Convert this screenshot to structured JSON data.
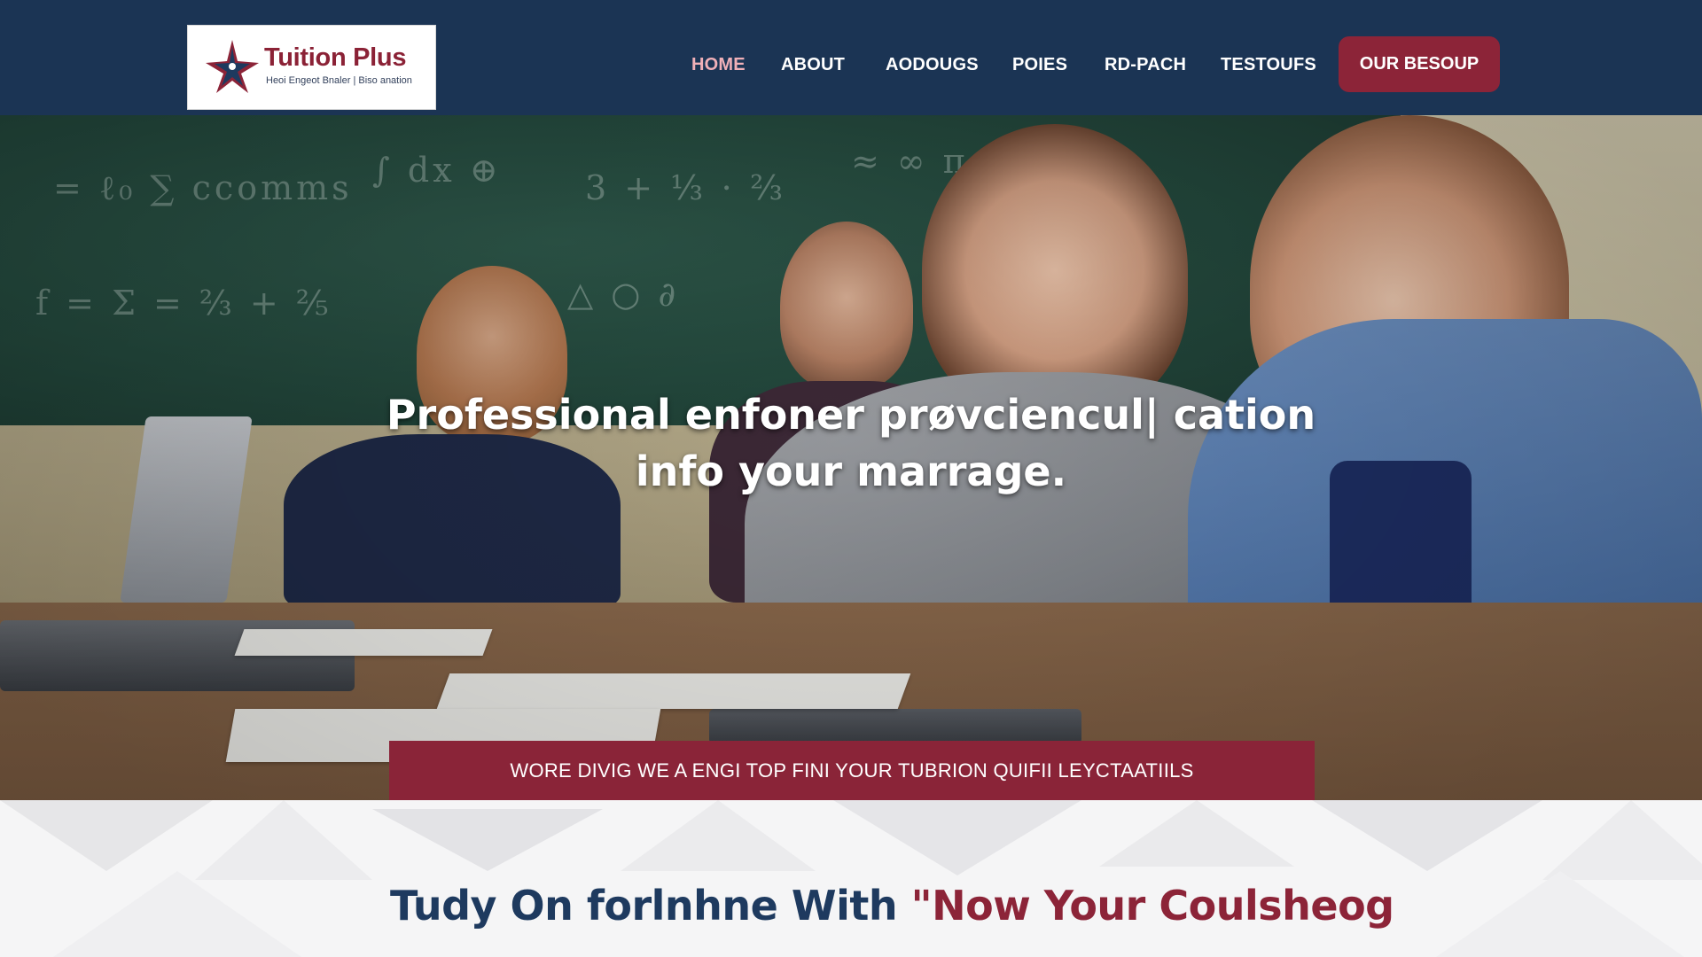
{
  "brand": {
    "name": "Tuition Plus",
    "tagline": "Heoi Engeot Bnaler | Biso anation",
    "colors": {
      "primary_navy": "#1b3458",
      "accent_maroon": "#8c2438",
      "text_white": "#ffffff"
    }
  },
  "nav": {
    "items": [
      {
        "label": "HOME"
      },
      {
        "label": "ABOUT"
      },
      {
        "label": "AODOUGS"
      },
      {
        "label": "POIES"
      },
      {
        "label": "RD-PACH"
      },
      {
        "label": "TESTOUFS"
      }
    ],
    "cta_label": "OUR BESOUP"
  },
  "hero": {
    "heading_line1": "Professional enfoner prøvciencul| cation",
    "heading_line2": "info your marrage.",
    "banner_text": "WORE DIVIG WE A ENGI TOP FINI YOUR TUBRION QUIFII LEYCTAATIILS"
  },
  "section": {
    "heading_main": "Tudy On forlnhne With ",
    "heading_accent": "\"Now Your Coulsheog"
  }
}
